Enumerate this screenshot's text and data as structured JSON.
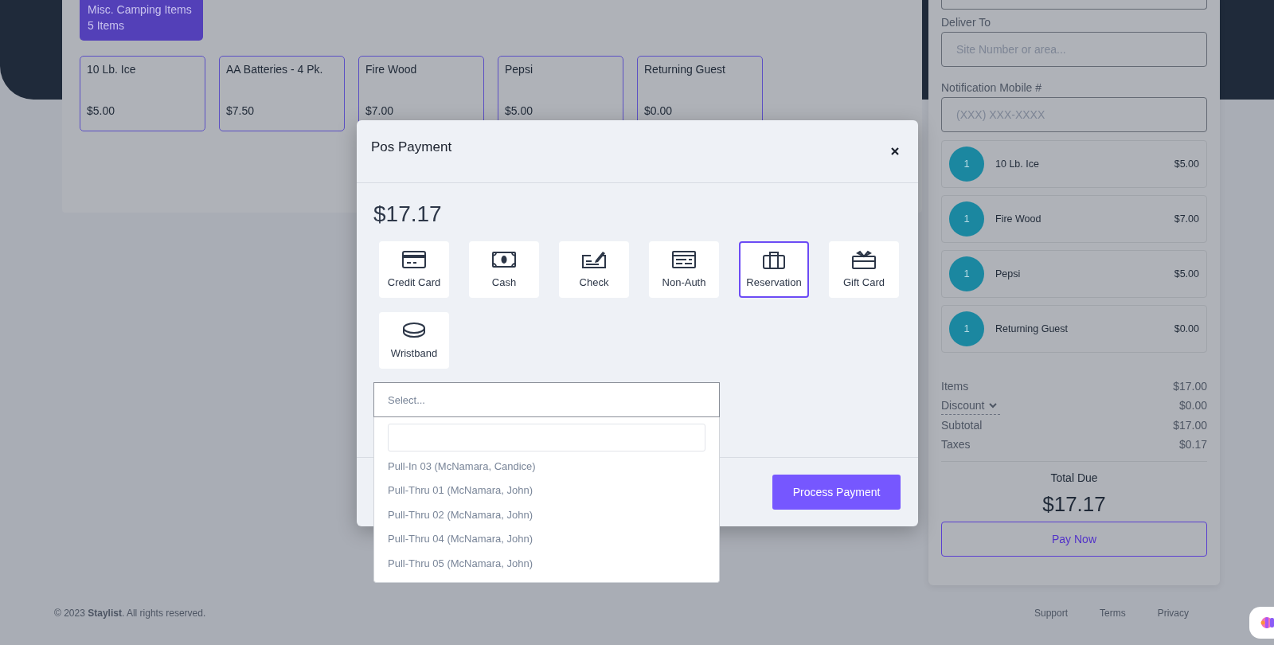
{
  "category": {
    "name": "Misc. Camping Items",
    "count": "5 Items"
  },
  "products": [
    {
      "name": "10 Lb. Ice",
      "price": "$5.00"
    },
    {
      "name": "AA Batteries - 4 Pk.",
      "price": "$7.50"
    },
    {
      "name": "Fire Wood",
      "price": "$7.00"
    },
    {
      "name": "Pepsi",
      "price": "$5.00"
    },
    {
      "name": "Returning Guest",
      "price": "$0.00"
    }
  ],
  "order_panel": {
    "fields": [
      {
        "label": "Deliver To",
        "placeholder": "Site Number or area..."
      },
      {
        "label": "Notification Mobile #",
        "placeholder": "(XXX) XXX-XXXX"
      }
    ],
    "cart": [
      {
        "qty": "1",
        "name": "10 Lb. Ice",
        "price": "$5.00"
      },
      {
        "qty": "1",
        "name": "Fire Wood",
        "price": "$7.00"
      },
      {
        "qty": "1",
        "name": "Pepsi",
        "price": "$5.00"
      },
      {
        "qty": "1",
        "name": "Returning Guest",
        "price": "$0.00"
      }
    ],
    "summary": [
      {
        "label": "Items",
        "value": "$17.00",
        "kind": "plain"
      },
      {
        "label": "Discount",
        "value": "$0.00",
        "kind": "dropdown"
      },
      {
        "label": "Subtotal",
        "value": "$17.00",
        "kind": "plain"
      },
      {
        "label": "Taxes",
        "value": "$0.17",
        "kind": "plain"
      }
    ],
    "total": {
      "label": "Total Due",
      "amount": "$17.17"
    },
    "pay_button": "Pay Now"
  },
  "footer": {
    "copyright": "© 2023 **Staylist**. All rights reserved.",
    "links": [
      "Support",
      "Terms",
      "Privacy"
    ]
  },
  "modal": {
    "title": "Pos Payment",
    "amount": "$17.17",
    "methods": [
      {
        "label": "Credit Card",
        "kind": "credit-card",
        "selected": false
      },
      {
        "label": "Cash",
        "kind": "cash",
        "selected": false
      },
      {
        "label": "Check",
        "kind": "check",
        "selected": false
      },
      {
        "label": "Non-Auth",
        "kind": "non-auth",
        "selected": false
      },
      {
        "label": "Reservation",
        "kind": "reservation",
        "selected": true
      },
      {
        "label": "Gift Card",
        "kind": "gift-card",
        "selected": false
      },
      {
        "label": "Wristband",
        "kind": "wristband",
        "selected": false
      }
    ],
    "select": {
      "placeholder": "Select...",
      "options": [
        "Pull-In 03 (McNamara, Candice)",
        "Pull-Thru 01 (McNamara, John)",
        "Pull-Thru 02 (McNamara, John)",
        "Pull-Thru 04 (McNamara, John)",
        "Pull-Thru 05 (McNamara, John)"
      ]
    },
    "submit": "Process Payment"
  }
}
